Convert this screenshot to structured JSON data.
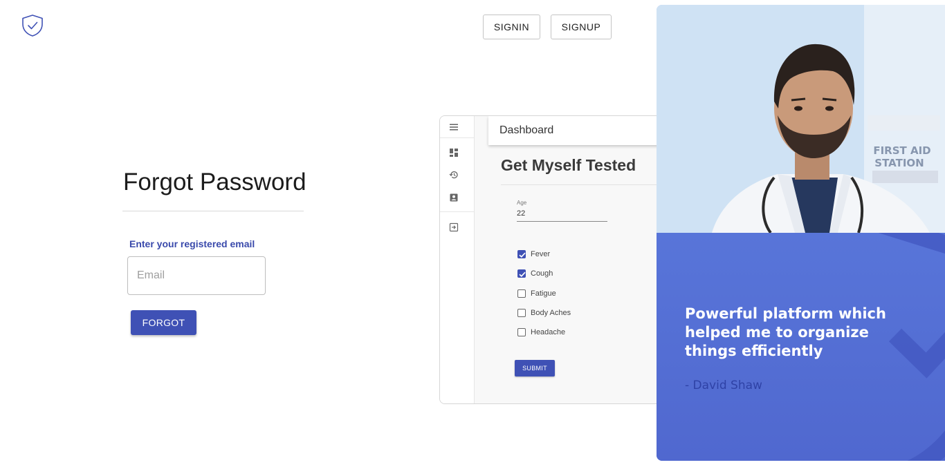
{
  "header": {
    "logo_icon": "shield-check-icon",
    "signin_label": "SIGNIN",
    "signup_label": "SIGNUP"
  },
  "form": {
    "title": "Forgot Password",
    "email_label": "Enter your registered email",
    "email_placeholder": "Email",
    "email_value": "",
    "submit_label": "FORGOT",
    "accent_color": "#3f51b5"
  },
  "preview": {
    "header_title": "Dashboard",
    "page_title": "Get Myself Tested",
    "sidebar_icons": [
      "menu-icon",
      "dashboard-icon",
      "history-icon",
      "contact-icon",
      "logout-icon"
    ],
    "age_label": "Age",
    "age_value": "22",
    "symptoms": [
      {
        "label": "Fever",
        "checked": true
      },
      {
        "label": "Cough",
        "checked": true
      },
      {
        "label": "Fatigue",
        "checked": false
      },
      {
        "label": "Body Aches",
        "checked": false
      },
      {
        "label": "Headache",
        "checked": false
      }
    ],
    "submit_label": "SUBMIT"
  },
  "testimonial": {
    "quote": "Powerful platform which helped me to organize things efficiently",
    "author": "- David Shaw",
    "sign_text": [
      "FIRST AID",
      "STATION"
    ],
    "panel_color": "#5875d9"
  }
}
